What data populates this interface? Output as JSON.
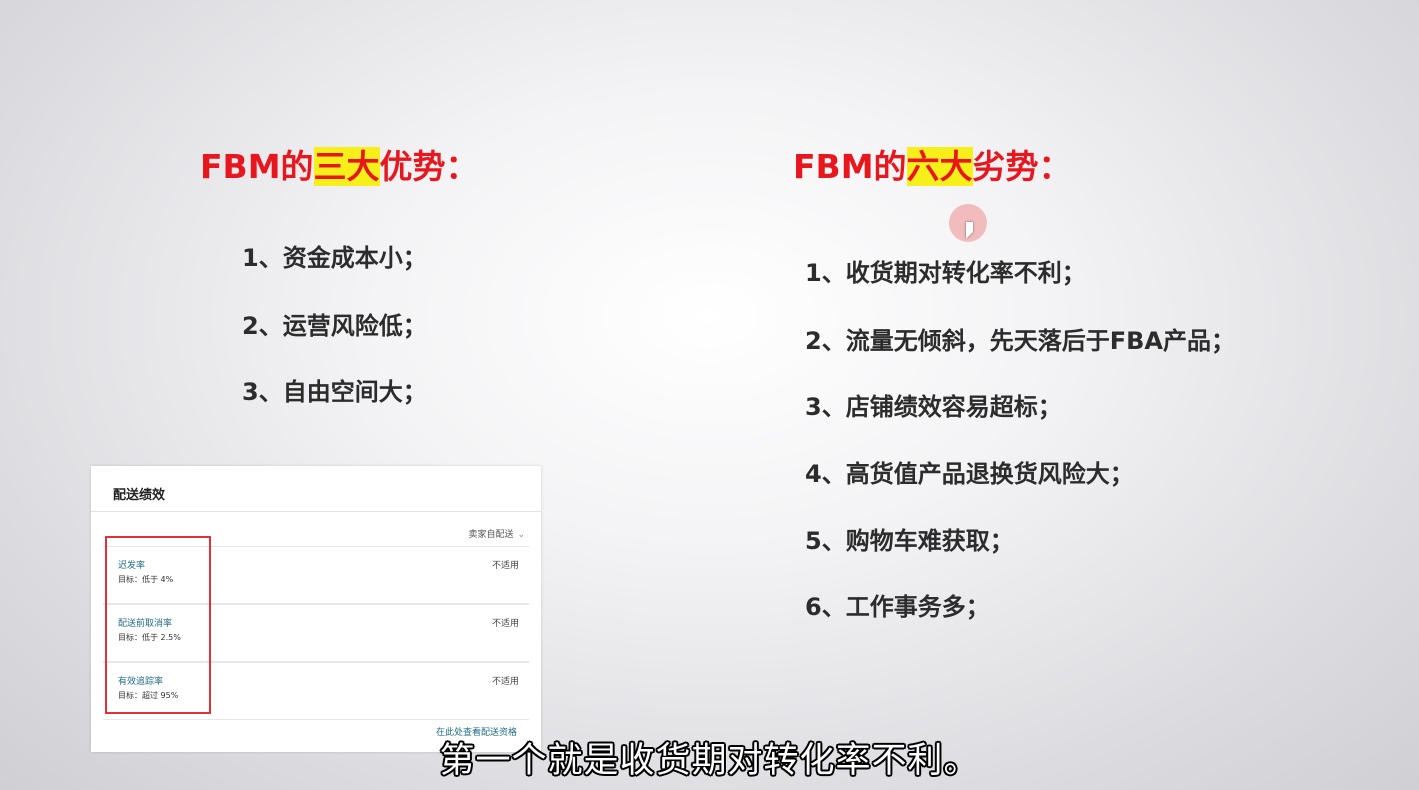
{
  "left_heading": {
    "prefix": "FBM的",
    "highlight": "三大",
    "suffix": "优势："
  },
  "right_heading": {
    "prefix": "FBM的",
    "highlight": "六大",
    "suffix": "劣势："
  },
  "advantages": [
    "1、资金成本小；",
    "2、运营风险低；",
    "3、自由空间大；"
  ],
  "disadvantages": [
    "1、收货期对转化率不利；",
    "2、流量无倾斜，先天落后于FBA产品；",
    "3、店铺绩效容易超标；",
    "4、高货值产品退换货风险大；",
    "5、购物车难获取；",
    "6、工作事务多；"
  ],
  "panel": {
    "title": "配送绩效",
    "select_value": "卖家自配送",
    "metrics": [
      {
        "name": "迟发率",
        "target": "目标：低于 4%",
        "status": "不适用"
      },
      {
        "name": "配送前取消率",
        "target": "目标：低于 2.5%",
        "status": "不适用"
      },
      {
        "name": "有效追踪率",
        "target": "目标：超过 95%",
        "status": "不适用"
      }
    ],
    "footer_link": "在此处查看配送资格"
  },
  "subtitle": "第一个就是收货期对转化率不利。",
  "colors": {
    "heading": "#e8161d",
    "highlight": "#f6ef1a",
    "link": "#1f6d8a",
    "red_box": "#e0303a"
  }
}
